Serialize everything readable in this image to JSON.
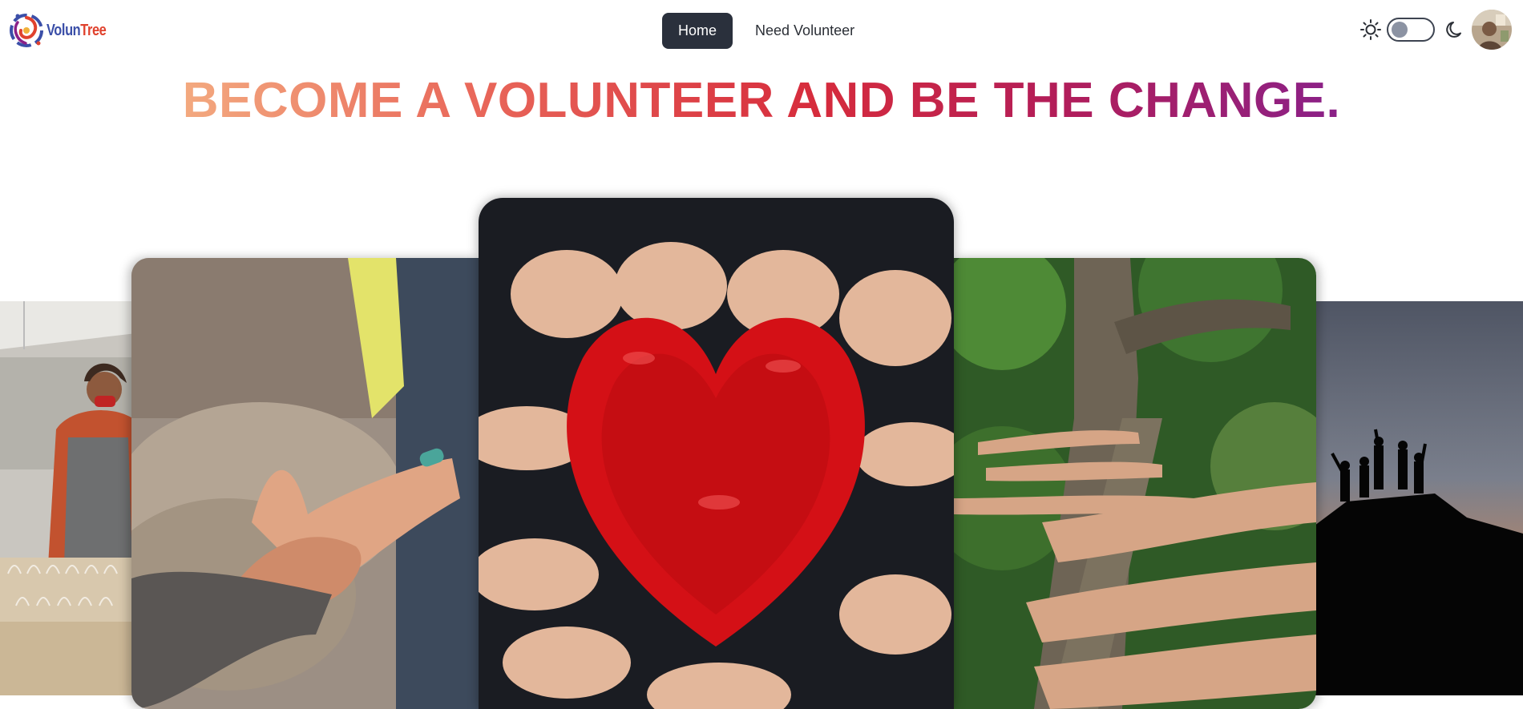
{
  "brand": {
    "name_part1": "Volun",
    "name_part2": "Tree"
  },
  "nav": {
    "links": [
      {
        "label": "Home",
        "active": true
      },
      {
        "label": "Need Volunteer",
        "active": false
      }
    ]
  },
  "theme_toggle": {
    "light_icon": "sun-icon",
    "dark_icon": "moon-icon",
    "state": "off"
  },
  "hero": {
    "title": "BECOME A VOLUNTEER AND BE THE CHANGE.",
    "gradient_colors": [
      "#f3a97f",
      "#e9685a",
      "#d62b3c",
      "#b31d58",
      "#8a2188"
    ]
  },
  "carousel": {
    "slides": [
      {
        "subject": "volunteer-packing-bags"
      },
      {
        "subject": "hands-touching"
      },
      {
        "subject": "red-painted-hands-heart"
      },
      {
        "subject": "hands-on-tree-trunk"
      },
      {
        "subject": "silhouettes-on-rock-at-sunset"
      }
    ]
  }
}
